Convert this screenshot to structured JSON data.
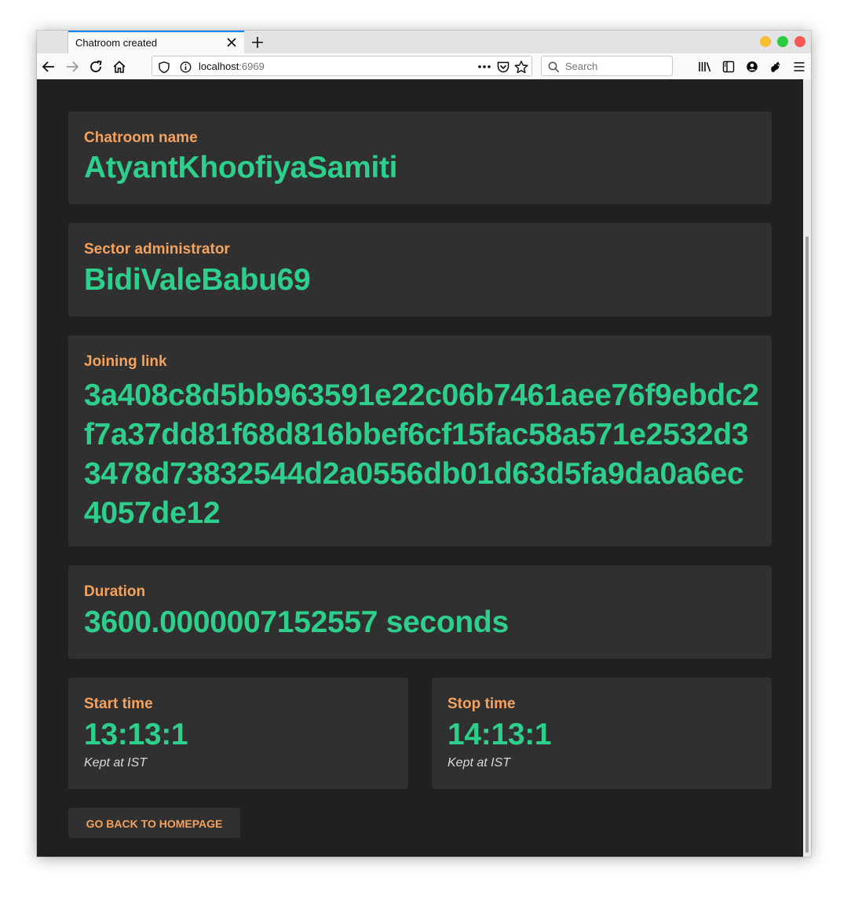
{
  "browser": {
    "tab_title": "Chatroom created",
    "url_host": "localhost",
    "url_port": ":6969",
    "search_placeholder": "Search",
    "traffic_colors": [
      "#f6bf34",
      "#2cca3f",
      "#f45a53"
    ],
    "accent": "#0a84ff"
  },
  "page": {
    "chatroom_name": {
      "label": "Chatroom name",
      "value": "AtyantKhoofiyaSamiti"
    },
    "administrator": {
      "label": "Sector administrator",
      "value": "BidiValeBabu69"
    },
    "joining_link": {
      "label": "Joining link",
      "value": "3a408c8d5bb963591e22c06b7461aee76f9ebdc2f7a37dd81f68d816bbef6cf15fac58a571e2532d33478d73832544d2a0556db01d63d5fa9da0a6ec4057de12"
    },
    "duration": {
      "label": "Duration",
      "value": "3600.0000007152557 seconds"
    },
    "start_time": {
      "label": "Start time",
      "value": "13:13:1",
      "zone": "Kept at IST"
    },
    "stop_time": {
      "label": "Stop time",
      "value": "14:13:1",
      "zone": "Kept at IST"
    },
    "back_button": "GO BACK TO HOMEPAGE",
    "colors": {
      "label": "#f4a25d",
      "value": "#2ece8c",
      "card": "#303030",
      "background": "#202020"
    }
  }
}
